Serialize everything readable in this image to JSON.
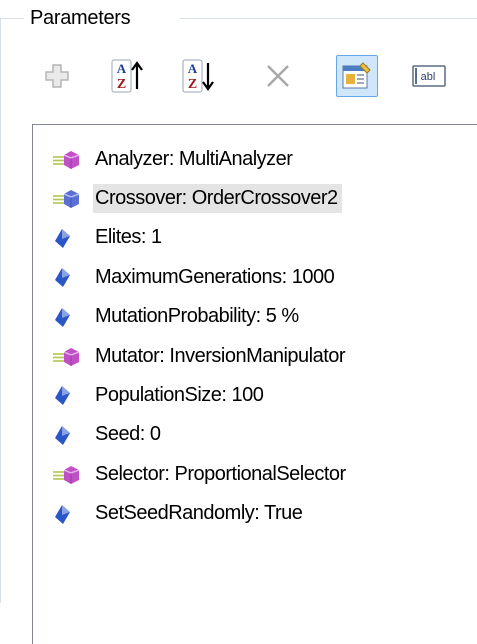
{
  "group": {
    "title": "Parameters"
  },
  "toolbar": {
    "buttons": [
      {
        "name": "add-button",
        "icon": "plus-icon",
        "enabled": false
      },
      {
        "name": "move-up-button",
        "icon": "sort-az-up-icon",
        "enabled": true
      },
      {
        "name": "move-down-button",
        "icon": "sort-az-down-icon",
        "enabled": true
      },
      {
        "name": "remove-button",
        "icon": "close-icon",
        "enabled": false
      },
      {
        "name": "show-details-button",
        "icon": "details-view-icon",
        "enabled": true,
        "pressed": true
      },
      {
        "name": "text-edit-button",
        "icon": "text-field-icon",
        "enabled": true
      }
    ]
  },
  "parameters": {
    "items": [
      {
        "label": "Analyzer: MultiAnalyzer",
        "icon": "operator-parameter-icon",
        "selected": false
      },
      {
        "label": "Crossover: OrderCrossover2",
        "icon": "operator-parameter-selected-icon",
        "selected": true
      },
      {
        "label": "Elites: 1",
        "icon": "value-parameter-icon",
        "selected": false
      },
      {
        "label": "MaximumGenerations: 1000",
        "icon": "value-parameter-icon",
        "selected": false
      },
      {
        "label": "MutationProbability: 5 %",
        "icon": "value-parameter-icon",
        "selected": false
      },
      {
        "label": "Mutator: InversionManipulator",
        "icon": "operator-parameter-icon",
        "selected": false
      },
      {
        "label": "PopulationSize: 100",
        "icon": "value-parameter-icon",
        "selected": false
      },
      {
        "label": "Seed: 0",
        "icon": "value-parameter-icon",
        "selected": false
      },
      {
        "label": "Selector: ProportionalSelector",
        "icon": "operator-parameter-icon",
        "selected": false
      },
      {
        "label": "SetSeedRandomly: True",
        "icon": "value-parameter-icon",
        "selected": false
      }
    ]
  },
  "colors": {
    "operator_gem": "#c04fc8",
    "selected_gem": "#5b6fd6",
    "value_gem": "#2a56c8",
    "gem_arrow": "#b7c95a",
    "selection_bg": "#e4e4e4",
    "pressed_bg": "#cfe6fb"
  }
}
